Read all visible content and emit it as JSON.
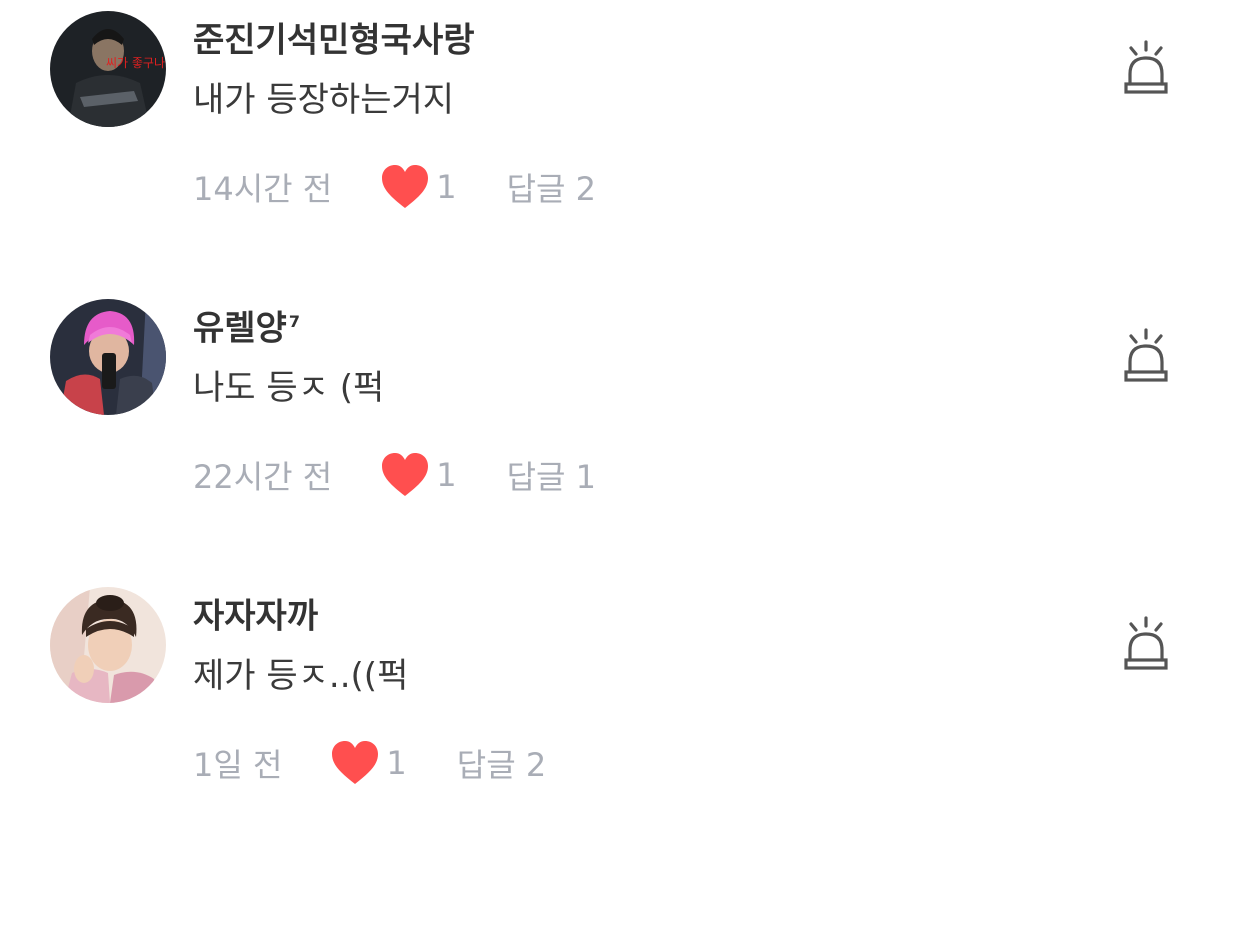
{
  "comments": [
    {
      "username": "준진기석민형국사랑",
      "username_sup": "",
      "text": "내가 등장하는거지",
      "time": "14시간 전",
      "likes": "1",
      "reply": "답글 2",
      "avatar_caption": "씨가 좋구나"
    },
    {
      "username": "유렐양",
      "username_sup": "7",
      "text": "나도 등ㅈ (퍽",
      "time": "22시간 전",
      "likes": "1",
      "reply": "답글 1"
    },
    {
      "username": "자자자까",
      "username_sup": "",
      "text": "제가 등ㅈ..((퍽",
      "time": "1일 전",
      "likes": "1",
      "reply": "답글 2"
    }
  ],
  "colors": {
    "heart": "#ff4f4f",
    "meta": "#a9adb6",
    "username": "#333333",
    "icon": "#555555"
  },
  "icons": {
    "like": "heart-icon",
    "report": "siren-icon"
  }
}
